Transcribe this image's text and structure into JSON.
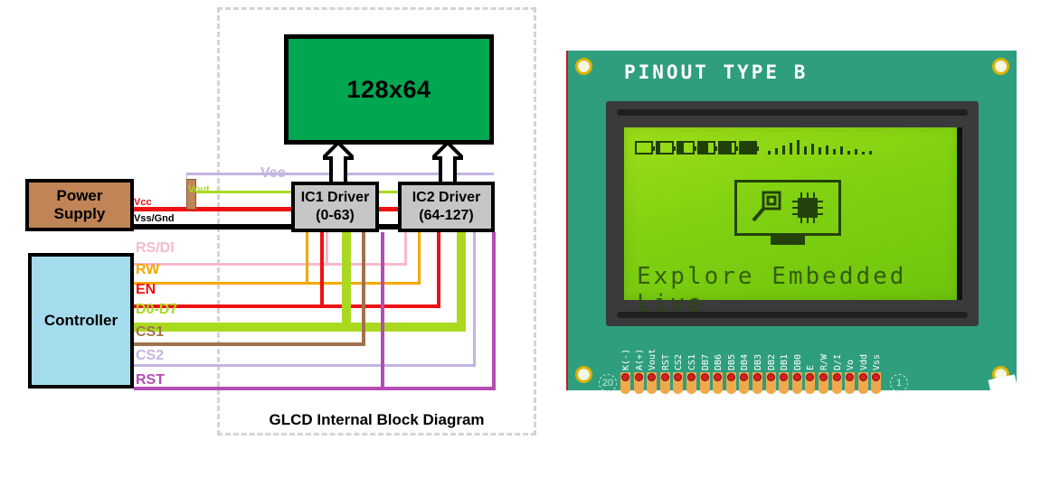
{
  "diagram": {
    "caption": "GLCD Internal Block Diagram",
    "display_label": "128x64",
    "drivers": [
      {
        "name": "IC1 Driver",
        "range": "(0-63)"
      },
      {
        "name": "IC2 Driver",
        "range": "(64-127)"
      }
    ],
    "blocks": {
      "power_supply_line1": "Power",
      "power_supply_line2": "Supply",
      "controller": "Controller"
    },
    "power_signals": [
      {
        "label": "Vee",
        "color": "#c3b4e0"
      },
      {
        "label": "Vout",
        "color": "#aada20"
      },
      {
        "label": "Vcc",
        "color": "#ee1111"
      },
      {
        "label": "Vss/Gnd",
        "color": "#000000"
      }
    ],
    "bus_signals": [
      {
        "label": "RS/DI",
        "color": "#f7b9cf"
      },
      {
        "label": "RW",
        "color": "#f5a800"
      },
      {
        "label": "EN",
        "color": "#ee1111"
      },
      {
        "label": "D0-D7",
        "color": "#aada20"
      },
      {
        "label": "CS1",
        "color": "#a0724c"
      },
      {
        "label": "CS2",
        "color": "#c3b4e0"
      },
      {
        "label": "RST",
        "color": "#b44cb4"
      }
    ]
  },
  "module": {
    "title": "PINOUT TYPE B",
    "screen_text": "Explore Embedded Live",
    "battery_fills": [
      0,
      20,
      40,
      60,
      80,
      100
    ],
    "signal_bars": [
      4,
      7,
      10,
      13,
      16,
      9,
      12,
      8,
      10,
      6,
      9,
      4,
      6,
      3,
      4
    ],
    "pin_first_number": "20",
    "pin_last_number": "1",
    "pins": [
      "K(-)",
      "A(+)",
      "Vout",
      "RST",
      "CS2",
      "CS1",
      "DB7",
      "DB6",
      "DB5",
      "DB4",
      "DB3",
      "DB2",
      "DB1",
      "DB0",
      "E",
      "R/W",
      "D/I",
      "Vo",
      "Vdd",
      "Vss"
    ]
  },
  "colors": {
    "board": "#2f9e7e",
    "screen_green": "#00a650",
    "lcd_green": "#8ed414",
    "driver_gray": "#c6c6c6",
    "psu_brown": "#c08457",
    "controller_blue": "#a4dced"
  }
}
